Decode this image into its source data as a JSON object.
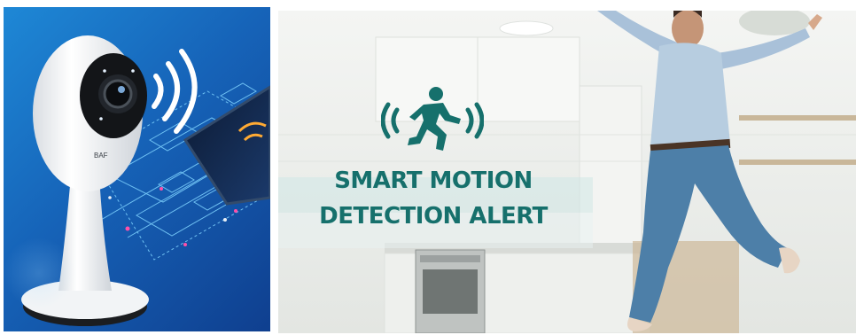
{
  "left_panel": {
    "product": "smart camera with wireless signal",
    "brand_fragment": "BAF",
    "colors": {
      "bg_top": "#1e88d6",
      "bg_bottom": "#0f3f8f",
      "camera_body": "#f5f6f7",
      "lens": "#1a1d22",
      "signal": "#ffffff"
    }
  },
  "right_panel": {
    "icon": "running-person-motion-icon",
    "headline_line1": "SMART MOTION",
    "headline_line2": "DETECTION ALERT",
    "colors": {
      "text": "#16706c",
      "icon": "#16706c",
      "band": "#cfe7e5"
    }
  }
}
